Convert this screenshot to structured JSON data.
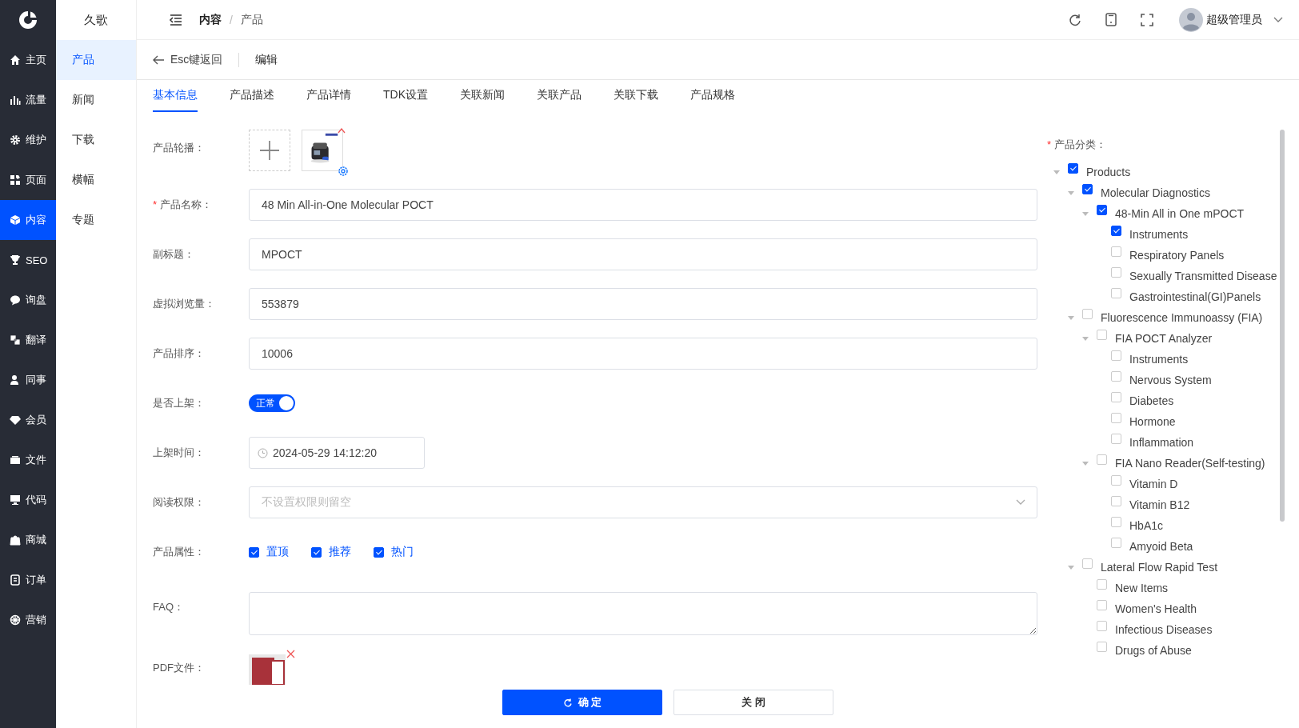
{
  "brand": {
    "title": "久歌"
  },
  "nav": [
    {
      "label": "主页",
      "selected": false
    },
    {
      "label": "流量",
      "selected": false
    },
    {
      "label": "维护",
      "selected": false
    },
    {
      "label": "页面",
      "selected": false
    },
    {
      "label": "内容",
      "selected": true
    },
    {
      "label": "SEO",
      "selected": false
    },
    {
      "label": "询盘",
      "selected": false
    },
    {
      "label": "翻译",
      "selected": false
    },
    {
      "label": "同事",
      "selected": false
    },
    {
      "label": "会员",
      "selected": false
    },
    {
      "label": "文件",
      "selected": false
    },
    {
      "label": "代码",
      "selected": false
    },
    {
      "label": "商城",
      "selected": false
    },
    {
      "label": "订单",
      "selected": false
    },
    {
      "label": "营销",
      "selected": false
    }
  ],
  "subnav": [
    {
      "label": "产品",
      "selected": true
    },
    {
      "label": "新闻",
      "selected": false
    },
    {
      "label": "下载",
      "selected": false
    },
    {
      "label": "横幅",
      "selected": false
    },
    {
      "label": "专题",
      "selected": false
    }
  ],
  "breadcrumb": [
    "内容",
    "产品"
  ],
  "breadcrumb_separator": "/",
  "user": {
    "name": "超级管理员"
  },
  "back": {
    "label": "Esc键返回"
  },
  "page_title": "编辑",
  "tabs": [
    {
      "label": "基本信息",
      "selected": true
    },
    {
      "label": "产品描述",
      "selected": false
    },
    {
      "label": "产品详情",
      "selected": false
    },
    {
      "label": "TDK设置",
      "selected": false
    },
    {
      "label": "关联新闻",
      "selected": false
    },
    {
      "label": "关联产品",
      "selected": false
    },
    {
      "label": "关联下载",
      "selected": false
    },
    {
      "label": "产品规格",
      "selected": false
    }
  ],
  "form": [
    {
      "kind": "images",
      "label": "产品轮播："
    },
    {
      "kind": "text",
      "label": "产品名称：",
      "required_mark": "*",
      "value": "48 Min All-in-One Molecular POCT"
    },
    {
      "kind": "text",
      "label": "副标题：",
      "value": "MPOCT"
    },
    {
      "kind": "text",
      "label": "虚拟浏览量：",
      "value": "553879"
    },
    {
      "kind": "text",
      "label": "产品排序：",
      "value": "10006"
    },
    {
      "kind": "switch",
      "label": "是否上架：",
      "on": true,
      "text": "正常"
    },
    {
      "kind": "date",
      "label": "上架时间：",
      "value": "2024-05-29 14:12:20"
    },
    {
      "kind": "select",
      "label": "阅读权限：",
      "placeholder": "不设置权限则留空"
    },
    {
      "kind": "checks",
      "label": "产品属性：",
      "options": [
        {
          "label": "置顶",
          "checked": true
        },
        {
          "label": "推荐",
          "checked": true
        },
        {
          "label": "热门",
          "checked": true
        }
      ]
    },
    {
      "kind": "textarea",
      "label": "FAQ："
    },
    {
      "kind": "file",
      "label": "PDF文件："
    }
  ],
  "category": {
    "label": "产品分类：",
    "required_mark": "*",
    "tree": [
      {
        "label": "Products",
        "checked": true,
        "expanded": true,
        "children": [
          {
            "label": "Molecular Diagnostics",
            "checked": true,
            "expanded": true,
            "children": [
              {
                "label": "48-Min All in One mPOCT",
                "checked": true,
                "expanded": true,
                "children": [
                  {
                    "label": "Instruments",
                    "checked": true
                  },
                  {
                    "label": "Respiratory Panels",
                    "checked": false
                  },
                  {
                    "label": "Sexually Transmitted Disease",
                    "checked": false
                  },
                  {
                    "label": "Gastrointestinal(GI)Panels",
                    "checked": false
                  }
                ]
              }
            ]
          },
          {
            "label": "Fluorescence Immunoassy (FIA)",
            "checked": false,
            "expanded": true,
            "children": [
              {
                "label": "FIA POCT Analyzer",
                "checked": false,
                "expanded": true,
                "children": [
                  {
                    "label": "Instruments",
                    "checked": false
                  },
                  {
                    "label": "Nervous System",
                    "checked": false
                  },
                  {
                    "label": "Diabetes",
                    "checked": false
                  },
                  {
                    "label": "Hormone",
                    "checked": false
                  },
                  {
                    "label": "Inflammation",
                    "checked": false
                  }
                ]
              },
              {
                "label": "FIA Nano Reader(Self-testing)",
                "checked": false,
                "expanded": true,
                "children": [
                  {
                    "label": "Vitamin D",
                    "checked": false
                  },
                  {
                    "label": "Vitamin B12",
                    "checked": false
                  },
                  {
                    "label": "HbA1c",
                    "checked": false
                  },
                  {
                    "label": "Amyoid Beta",
                    "checked": false
                  }
                ]
              }
            ]
          },
          {
            "label": "Lateral Flow Rapid Test",
            "checked": false,
            "expanded": true,
            "children": [
              {
                "label": "New Items",
                "checked": false
              },
              {
                "label": "Women's Health",
                "checked": false
              },
              {
                "label": "Infectious Diseases",
                "checked": false
              },
              {
                "label": "Drugs of Abuse",
                "checked": false
              }
            ]
          }
        ]
      }
    ]
  },
  "buttons": [
    {
      "label": "确 定",
      "kind": "primary"
    },
    {
      "label": "关 闭",
      "kind": "default"
    }
  ]
}
